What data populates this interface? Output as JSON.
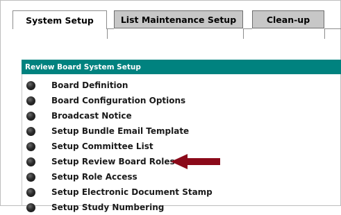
{
  "tabs": [
    {
      "label": "System Setup",
      "active": true
    },
    {
      "label": "List Maintenance Setup",
      "active": false
    },
    {
      "label": "Clean-up",
      "active": false
    }
  ],
  "panel": {
    "title": "Review Board System Setup",
    "header_color": "#00827f",
    "items": [
      {
        "label": "Board Definition"
      },
      {
        "label": "Board Configuration Options"
      },
      {
        "label": "Broadcast Notice"
      },
      {
        "label": "Setup Bundle Email Template"
      },
      {
        "label": "Setup Committee List"
      },
      {
        "label": "Setup Review Board Roles"
      },
      {
        "label": "Setup Role Access"
      },
      {
        "label": "Setup Electronic Document Stamp"
      },
      {
        "label": "Setup Study Numbering"
      }
    ]
  },
  "annotation": {
    "icon": "arrow-left-icon",
    "color": "#8b0a1a"
  }
}
